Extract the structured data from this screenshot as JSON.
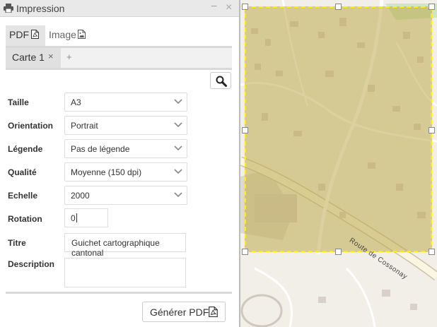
{
  "window": {
    "title": "Impression",
    "minimize_symbol": "−",
    "close_symbol": "×"
  },
  "format_tabs": [
    {
      "label": "PDF",
      "icon": "pdf-file-icon",
      "active": true
    },
    {
      "label": "Image",
      "icon": "image-file-icon",
      "active": false
    }
  ],
  "map_tabs": {
    "items": [
      {
        "label": "Carte 1",
        "close_symbol": "×"
      }
    ],
    "add_symbol": "+"
  },
  "form": {
    "size": {
      "label": "Taille",
      "value": "A3"
    },
    "orientation": {
      "label": "Orientation",
      "value": "Portrait"
    },
    "legend": {
      "label": "Légende",
      "value": "Pas de légende"
    },
    "quality": {
      "label": "Qualité",
      "value": "Moyenne (150 dpi)"
    },
    "scale": {
      "label": "Echelle",
      "value": "2000"
    },
    "rotation": {
      "label": "Rotation",
      "value": "0"
    },
    "title": {
      "label": "Titre",
      "value": "Guichet cartographique cantonal"
    },
    "description": {
      "label": "Description",
      "value": ""
    }
  },
  "actions": {
    "generate_label": "Générer PDF"
  },
  "map": {
    "road_label": "Route de Cossonay"
  },
  "colors": {
    "frame_border": "#ffee00",
    "frame_fill": "#bdaa4e",
    "map_background": "#f2efe9",
    "tab_active": "#e4e4e4"
  }
}
